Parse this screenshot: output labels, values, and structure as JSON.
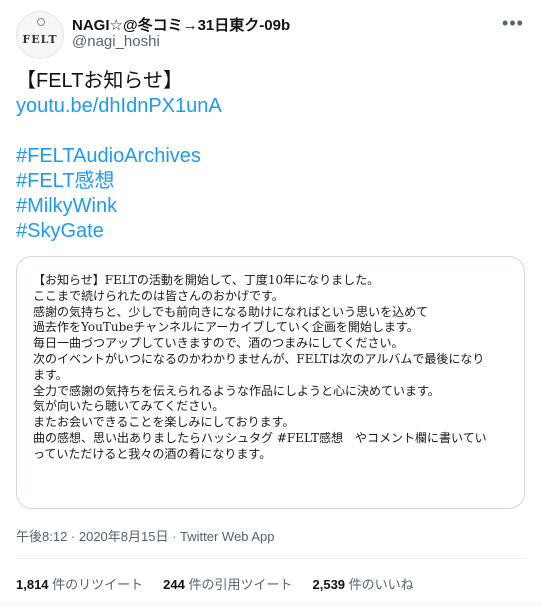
{
  "author": {
    "display_name": "NAGI☆@冬コミ→31日東ク-09b",
    "handle": "@nagi_hoshi",
    "avatar_text": "FELT"
  },
  "more_icon": "more-dots-icon",
  "tweet": {
    "title": "【FELTお知らせ】",
    "link": "youtu.be/dhIdnPX1unA",
    "hashtags": [
      "#FELTAudioArchives",
      "#FELT感想",
      "#MilkyWink",
      "#SkyGate"
    ]
  },
  "image_notice": {
    "lines": [
      "【お知らせ】FELTの活動を開始して、丁度10年になりました。",
      "ここまで続けられたのは皆さんのおかげです。",
      "感謝の気持ちと、少しでも前向きになる助けになればという思いを込めて",
      "過去作をYouTubeチャンネルにアーカイブしていく企画を開始します。",
      "毎日一曲づつアップしていきますので、酒のつまみにしてください。",
      "次のイベントがいつになるのかわかりませんが、FELTは次のアルバムで最後になり",
      "ます。",
      "全力で感謝の気持ちを伝えられるような作品にしようと心に決めています。",
      "気が向いたら聴いてみてください。",
      "またお会いできることを楽しみにしております。",
      "曲の感想、思い出ありましたらハッシュタグ #FELT感想　やコメント欄に書いてい",
      "っていただけると我々の酒の肴になります。"
    ]
  },
  "meta": {
    "datetime": "午後8:12 · 2020年8月15日",
    "separator": " · ",
    "via": "Twitter Web App"
  },
  "stats": [
    {
      "count": "1,814",
      "label": " 件のリツイート"
    },
    {
      "count": "244",
      "label": " 件の引用ツイート"
    },
    {
      "count": "2,539",
      "label": " 件のいいね"
    }
  ],
  "colors": {
    "link": "#1d9bf0",
    "text": "#0f1419",
    "secondary": "#536471",
    "border": "#cfd9de"
  }
}
